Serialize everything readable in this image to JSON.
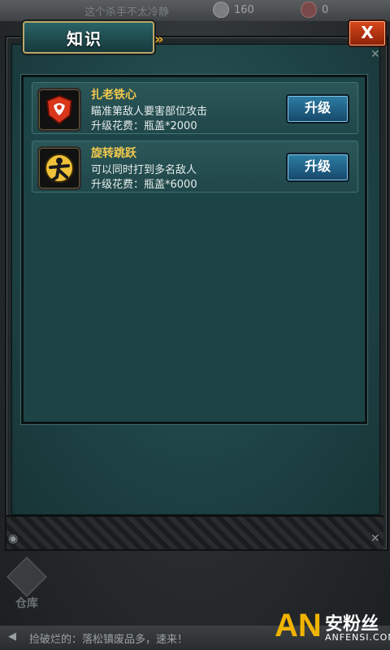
{
  "topbar": {
    "message": "这个杀手不太冷静",
    "resource_1": "160",
    "resource_2": "0"
  },
  "dialog": {
    "title": "知识",
    "close_label": "X"
  },
  "skills": [
    {
      "name": "扎老铁心",
      "description": "瞄准第敌人要害部位攻击",
      "cost": "升级花费：瓶盖*2000",
      "button": "升级",
      "icon": "heart-target-icon",
      "icon_bg": "#d9361b"
    },
    {
      "name": "旋转跳跃",
      "description": "可以同时打到多名敌人",
      "cost": "升级花费：瓶盖*6000",
      "button": "升级",
      "icon": "spinning-jump-icon",
      "icon_bg": "#f0c23a"
    }
  ],
  "bottom": {
    "warehouse_label": "仓库",
    "ticker": "捡破烂的：落松镇废品多，速来！"
  },
  "watermark": {
    "logo": "AN",
    "cn": "安粉丝",
    "en": "ANFENSI.COM"
  },
  "colors": {
    "accent": "#f2c94c",
    "button_blue": "#2d7ea5",
    "close_red": "#d9481c",
    "panel_teal": "#1f4446"
  }
}
